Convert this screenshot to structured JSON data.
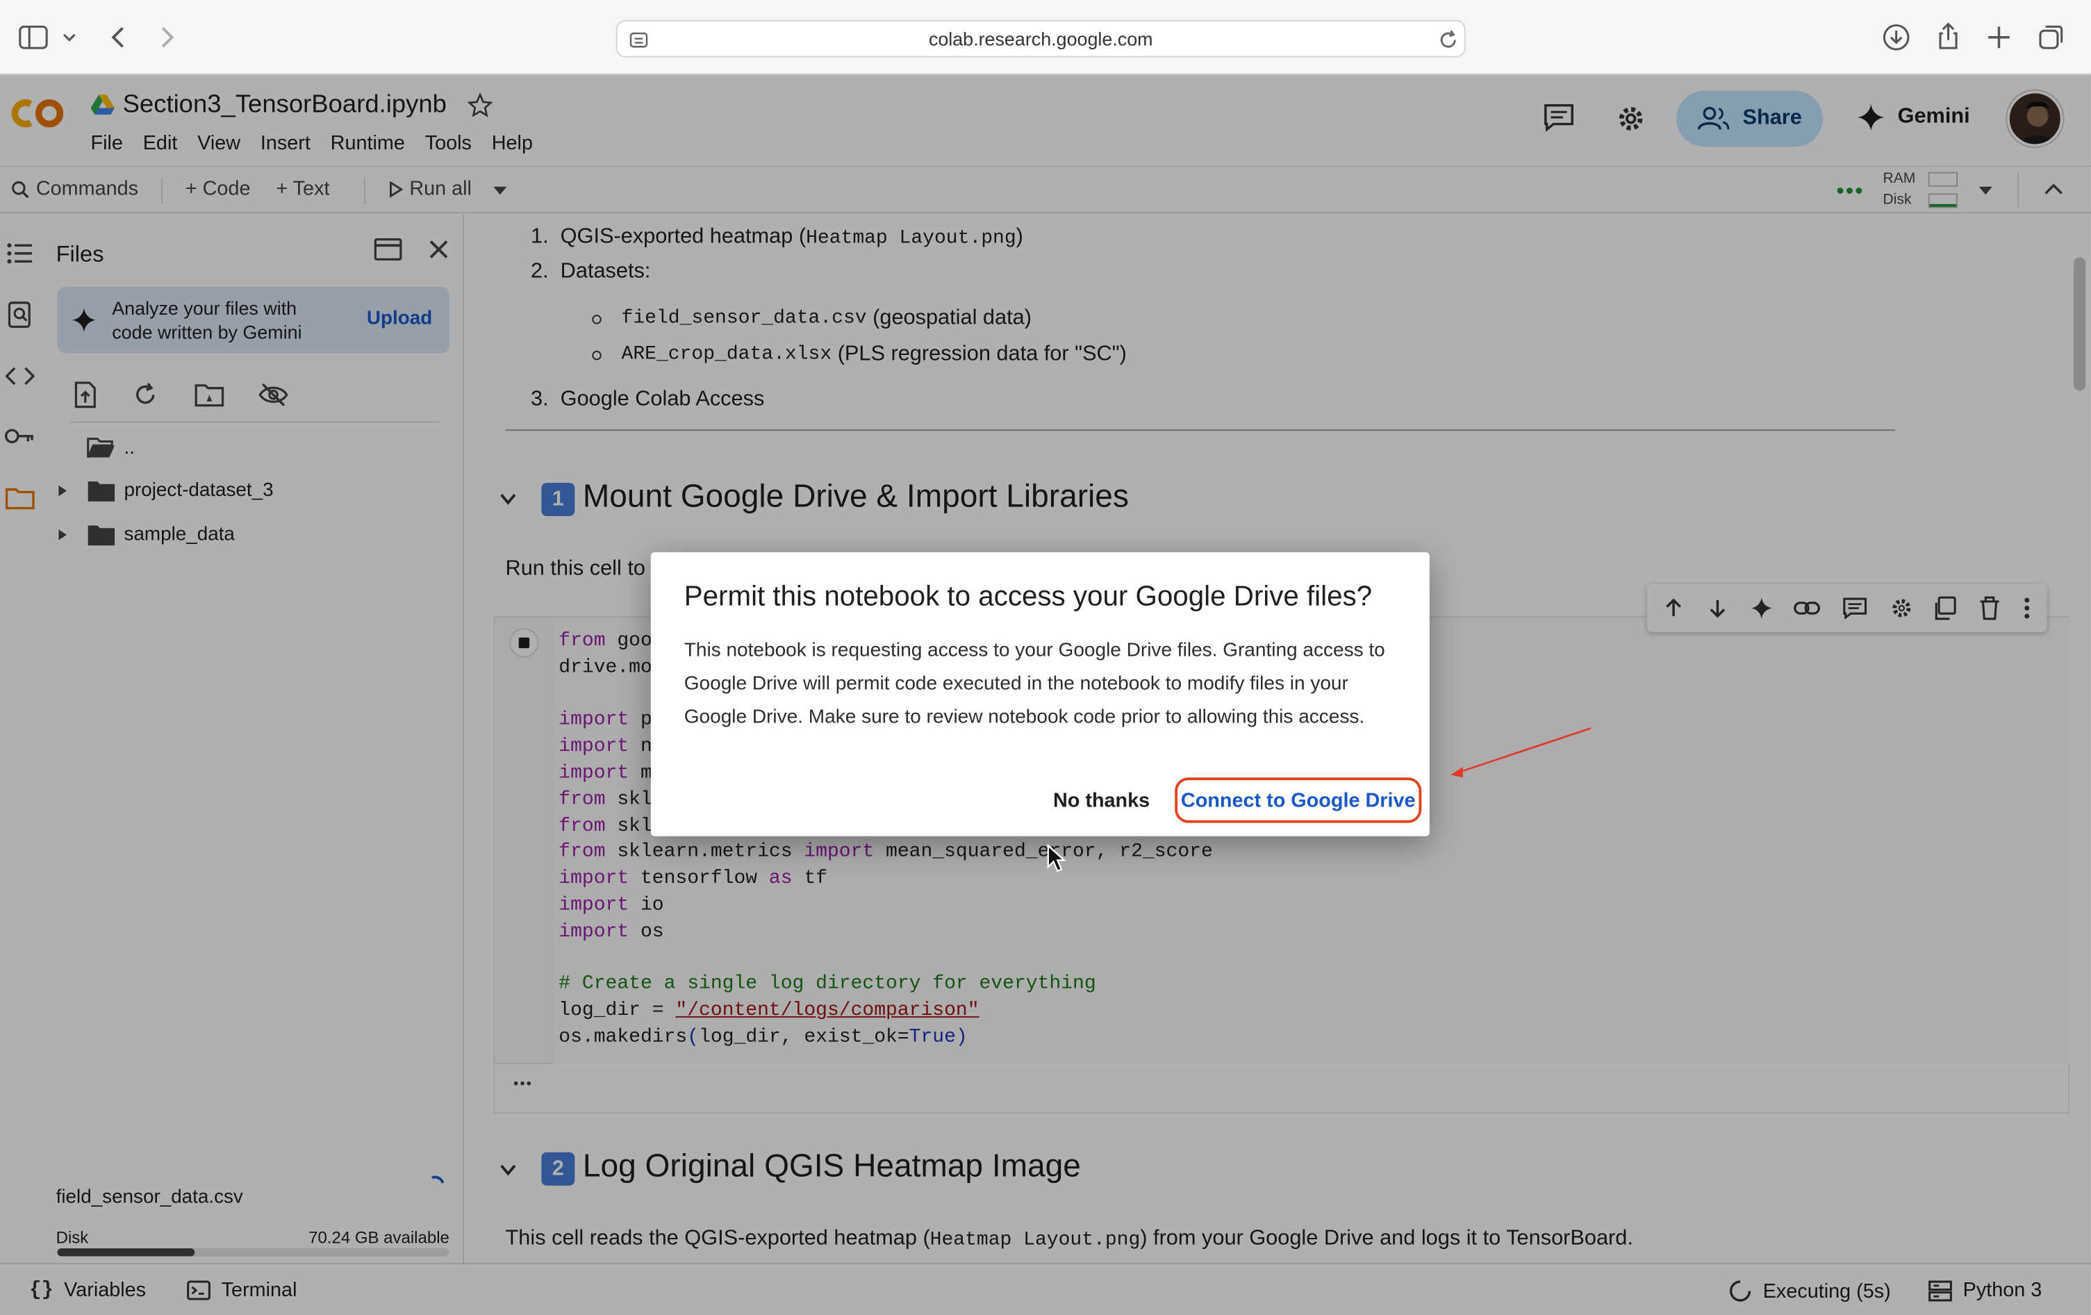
{
  "browser": {
    "url": "colab.research.google.com"
  },
  "header": {
    "notebook_title": "Section3_TensorBoard.ipynb",
    "menu": [
      "File",
      "Edit",
      "View",
      "Insert",
      "Runtime",
      "Tools",
      "Help"
    ],
    "share_label": "Share",
    "gemini_label": "Gemini"
  },
  "toolbar": {
    "commands": "Commands",
    "code": "+ Code",
    "text": "+ Text",
    "run_all": "Run all",
    "ram_label": "RAM",
    "disk_label": "Disk"
  },
  "files_panel": {
    "title": "Files",
    "gemini_prompt": "Analyze your files with code written by Gemini",
    "upload_label": "Upload",
    "tree": [
      {
        "name": "..",
        "expandable": false
      },
      {
        "name": "project-dataset_3",
        "expandable": true
      },
      {
        "name": "sample_data",
        "expandable": true
      }
    ],
    "uploading_file": "field_sensor_data.csv",
    "disk_label": "Disk",
    "disk_available": "70.24 GB available",
    "disk_used_fraction": 0.35
  },
  "notebook": {
    "list1": {
      "n": "1.",
      "text": "QGIS-exported heatmap (",
      "code": "Heatmap Layout.png",
      "after": ")"
    },
    "list2": {
      "n": "2.",
      "text": "Datasets:"
    },
    "bullet1": {
      "code": "field_sensor_data.csv",
      "text": "(geospatial data)"
    },
    "bullet2": {
      "code": "ARE_crop_data.xlsx",
      "text": "(PLS regression data for \"SC\")"
    },
    "list3": {
      "n": "3.",
      "text": "Google Colab Access"
    },
    "section1": {
      "emoji": "1",
      "title": "Mount Google Drive & Import Libraries"
    },
    "section1_text": "Run this cell to",
    "code_lines": [
      [
        [
          "kw",
          "from"
        ],
        [
          "p",
          " goo"
        ]
      ],
      [
        [
          "p",
          "drive.mo"
        ]
      ],
      [
        [
          "p",
          ""
        ]
      ],
      [
        [
          "kw",
          "import"
        ],
        [
          "p",
          " p"
        ]
      ],
      [
        [
          "kw",
          "import"
        ],
        [
          "p",
          " n"
        ]
      ],
      [
        [
          "kw",
          "import"
        ],
        [
          "p",
          " m"
        ]
      ],
      [
        [
          "kw",
          "from"
        ],
        [
          "p",
          " skl"
        ]
      ],
      [
        [
          "kw",
          "from"
        ],
        [
          "p",
          " skl"
        ]
      ],
      [
        [
          "kw",
          "from"
        ],
        [
          "p",
          " sklearn.metrics "
        ],
        [
          "kw",
          "import"
        ],
        [
          "p",
          " mean_squared_error, r2_score"
        ]
      ],
      [
        [
          "kw",
          "import"
        ],
        [
          "p",
          " tensorflow "
        ],
        [
          "kw",
          "as"
        ],
        [
          "p",
          " tf"
        ]
      ],
      [
        [
          "kw",
          "import"
        ],
        [
          "p",
          " io"
        ]
      ],
      [
        [
          "kw",
          "import"
        ],
        [
          "p",
          " os"
        ]
      ],
      [
        [
          "p",
          ""
        ]
      ],
      [
        [
          "cm",
          "# Create a single log directory for everything"
        ]
      ],
      [
        [
          "p",
          "log_dir = "
        ],
        [
          "str",
          "\"/content/logs/comparison\""
        ]
      ],
      [
        [
          "p",
          "os.makedirs"
        ],
        [
          "bl",
          "("
        ],
        [
          "p",
          "log_dir, exist_ok="
        ],
        [
          "bl",
          "True"
        ],
        [
          "bl",
          ")"
        ]
      ]
    ],
    "output_ellipsis": "•••",
    "section2": {
      "emoji": "2",
      "title": "Log Original QGIS Heatmap Image"
    },
    "section2_text_before": "This cell reads the QGIS-exported heatmap (",
    "section2_code": "Heatmap Layout.png",
    "section2_text_after": ") from your Google Drive and logs it to TensorBoard."
  },
  "dialog": {
    "title": "Permit this notebook to access your Google Drive files?",
    "body": "This notebook is requesting access to your Google Drive files. Granting access to Google Drive will permit code executed in the notebook to modify files in your Google Drive. Make sure to review notebook code prior to allowing this access.",
    "no_thanks": "No thanks",
    "connect": "Connect to Google Drive"
  },
  "statusbar": {
    "variables": "Variables",
    "terminal": "Terminal",
    "executing": "Executing (5s)",
    "runtime": "Python 3"
  },
  "colors": {
    "accent_blue": "#1a57c7",
    "share_bg": "#c2e7ff",
    "highlight_red": "#e0441f",
    "colab_orange": "#f9ab00"
  }
}
